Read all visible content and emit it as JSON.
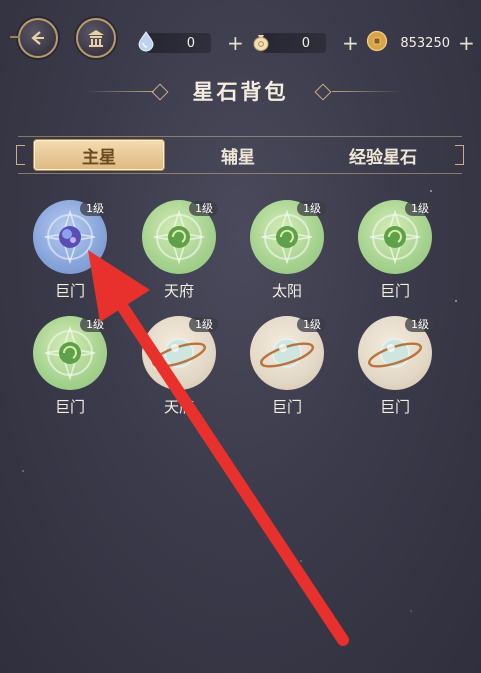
{
  "resources": [
    {
      "icon": "water-drop-icon",
      "value": "0"
    },
    {
      "icon": "money-bag-icon",
      "value": "0"
    },
    {
      "icon": "coin-icon",
      "value": "853250"
    }
  ],
  "plus_symbol": "+",
  "title": "星石背包",
  "tabs": [
    {
      "label": "主星",
      "active": true
    },
    {
      "label": "辅星",
      "active": false
    },
    {
      "label": "经验星石",
      "active": false
    }
  ],
  "stones": [
    {
      "name": "巨门",
      "level": "1级",
      "color": "blue"
    },
    {
      "name": "天府",
      "level": "1级",
      "color": "green"
    },
    {
      "name": "太阳",
      "level": "1级",
      "color": "green"
    },
    {
      "name": "巨门",
      "level": "1级",
      "color": "green"
    },
    {
      "name": "巨门",
      "level": "1级",
      "color": "green"
    },
    {
      "name": "天府",
      "level": "1级",
      "color": "beige"
    },
    {
      "name": "巨门",
      "level": "1级",
      "color": "beige"
    },
    {
      "name": "巨门",
      "level": "1级",
      "color": "beige"
    }
  ],
  "colors": {
    "accent_gold": "#c9b080",
    "active_tab": "#deb882",
    "annotation_arrow": "#e8312c"
  }
}
